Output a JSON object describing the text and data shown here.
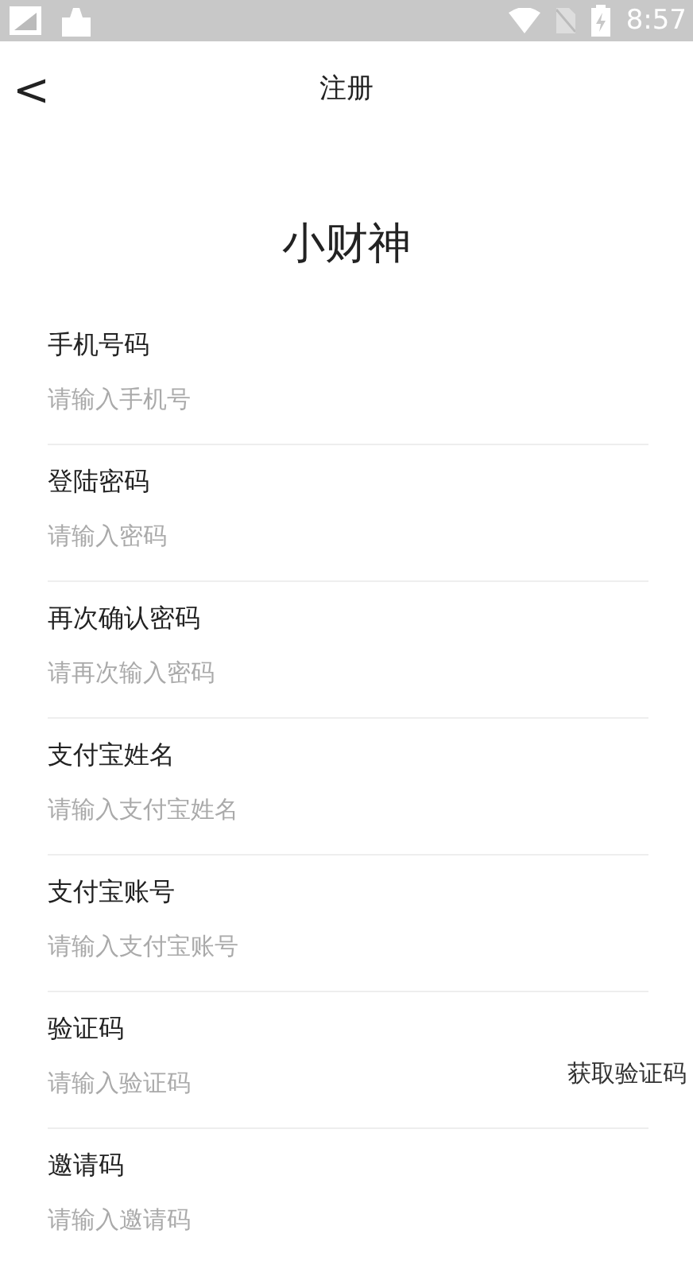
{
  "status_bar": {
    "time": "8:57"
  },
  "nav": {
    "back": "<",
    "title": "注册"
  },
  "app_name": "小财神",
  "fields": [
    {
      "label": "手机号码",
      "placeholder": "请输入手机号"
    },
    {
      "label": "登陆密码",
      "placeholder": "请输入密码"
    },
    {
      "label": "再次确认密码",
      "placeholder": "请再次输入密码"
    },
    {
      "label": "支付宝姓名",
      "placeholder": "请输入支付宝姓名"
    },
    {
      "label": "支付宝账号",
      "placeholder": "请输入支付宝账号"
    },
    {
      "label": "验证码",
      "placeholder": "请输入验证码",
      "action": "获取验证码"
    },
    {
      "label": "邀请码",
      "placeholder": "请输入邀请码"
    }
  ]
}
